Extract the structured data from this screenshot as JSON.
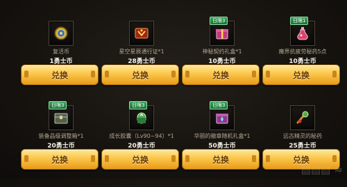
{
  "items": [
    {
      "name": "复活币",
      "cost": "1勇士币",
      "badge": null,
      "button": "兑换",
      "icon": "resurrection-coin-icon",
      "color": "#c9a227"
    },
    {
      "name": "星空星辰通行证*1",
      "cost": "28勇士币",
      "badge": null,
      "button": "兑换",
      "icon": "pass-ticket-icon",
      "color": "#d4402a"
    },
    {
      "name": "神秘契约礼盒*1",
      "cost": "10勇士币",
      "badge": "日限3",
      "button": "兑换",
      "icon": "contract-box-icon",
      "color": "#d84a8a"
    },
    {
      "name": "魔界抗疲劳秘药5点",
      "cost": "10勇士币",
      "badge": "日限1",
      "button": "兑换",
      "icon": "fatigue-potion-icon",
      "color": "#d8446c"
    },
    {
      "name": "装备品级调整箱*1",
      "cost": "20勇士币",
      "badge": "日限3",
      "button": "兑换",
      "icon": "grade-box-icon",
      "color": "#7a8a70"
    },
    {
      "name": "成长胶囊（Lv90~94）*1",
      "cost": "20勇士币",
      "badge": "日限3",
      "button": "兑换",
      "icon": "growth-capsule-icon",
      "color": "#4fb05a"
    },
    {
      "name": "华丽的徽章随机礼盒*1",
      "cost": "50勇士币",
      "badge": "日限3",
      "button": "兑换",
      "icon": "emblem-box-icon",
      "color": "#c05ab8"
    },
    {
      "name": "远古精灵的秘药",
      "cost": "25勇士币",
      "badge": null,
      "button": "兑换",
      "icon": "ancient-elixir-icon",
      "color": "#5aaa4a"
    }
  ]
}
